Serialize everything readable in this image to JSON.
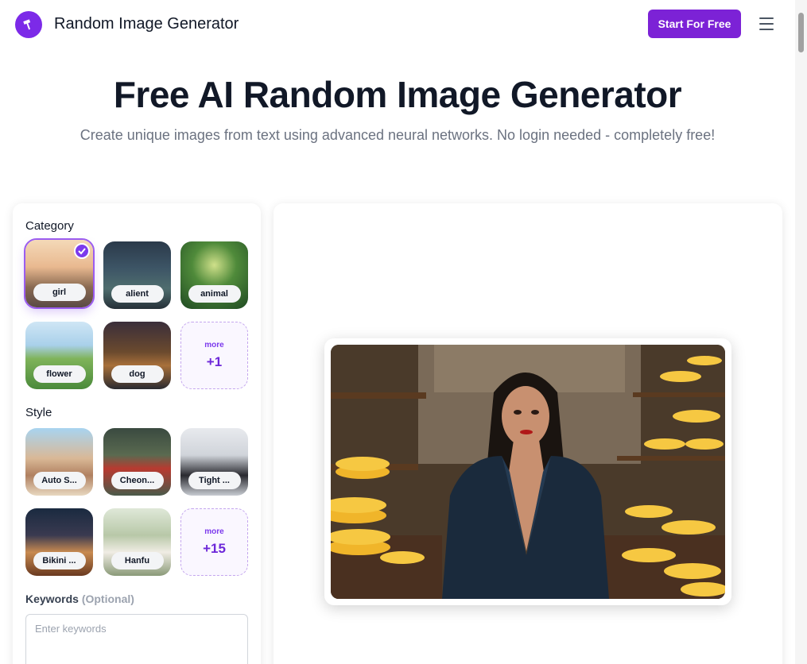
{
  "header": {
    "brand": "Random Image Generator",
    "cta_label": "Start For Free",
    "logo_icon": "brush-icon",
    "menu_icon": "hamburger-menu-icon",
    "accent_color": "#7c22d6"
  },
  "hero": {
    "title": "Free AI Random Image Generator",
    "subtitle": "Create unique images from text using advanced neural networks. No login needed - completely free!"
  },
  "category": {
    "label": "Category",
    "items": [
      {
        "label": "girl",
        "selected": true
      },
      {
        "label": "alient",
        "selected": false
      },
      {
        "label": "animal",
        "selected": false
      },
      {
        "label": "flower",
        "selected": false
      },
      {
        "label": "dog",
        "selected": false
      }
    ],
    "more_label": "more",
    "more_count": "+1"
  },
  "style": {
    "label": "Style",
    "items": [
      {
        "label": "Auto S..."
      },
      {
        "label": "Cheon..."
      },
      {
        "label": "Tight ..."
      },
      {
        "label": "Bikini ..."
      },
      {
        "label": "Hanfu"
      }
    ],
    "more_label": "more",
    "more_count": "+15"
  },
  "keywords": {
    "label": "Keywords",
    "optional": "(Optional)",
    "placeholder": "Enter keywords"
  }
}
